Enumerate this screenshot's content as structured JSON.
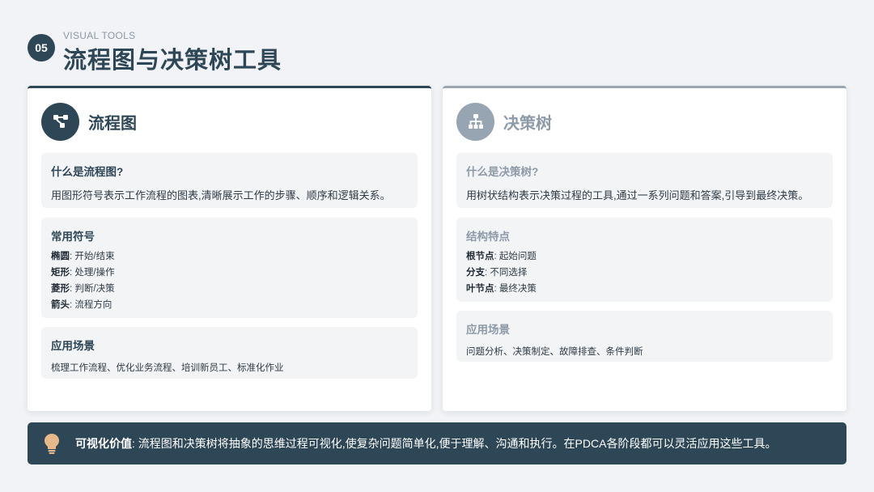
{
  "header": {
    "number": "05",
    "eyebrow": "VISUAL TOOLS",
    "title": "流程图与决策树工具"
  },
  "left_card": {
    "icon": "flowchart-icon",
    "title": "流程图",
    "what": {
      "title": "什么是流程图?",
      "text": "用图形符号表示工作流程的图表,清晰展示工作的步骤、顺序和逻辑关系。"
    },
    "symbols": {
      "title": "常用符号",
      "items": [
        {
          "term": "椭圆",
          "desc": ": 开始/结束"
        },
        {
          "term": "矩形",
          "desc": ": 处理/操作"
        },
        {
          "term": "菱形",
          "desc": ": 判断/决策"
        },
        {
          "term": "箭头",
          "desc": ": 流程方向"
        }
      ]
    },
    "scenarios": {
      "title": "应用场景",
      "text": "梳理工作流程、优化业务流程、培训新员工、标准化作业"
    }
  },
  "right_card": {
    "icon": "hierarchy-tree-icon",
    "title": "决策树",
    "what": {
      "title": "什么是决策树?",
      "text": "用树状结构表示决策过程的工具,通过一系列问题和答案,引导到最终决策。"
    },
    "structure": {
      "title": "结构特点",
      "items": [
        {
          "term": "根节点",
          "desc": ": 起始问题"
        },
        {
          "term": "分支",
          "desc": ": 不同选择"
        },
        {
          "term": "叶节点",
          "desc": ": 最终决策"
        }
      ]
    },
    "scenarios": {
      "title": "应用场景",
      "text": "问题分析、决策制定、故障排查、条件判断"
    }
  },
  "bottom": {
    "icon": "lightbulb-icon",
    "label": "可视化价值",
    "text": ": 流程图和决策树将抽象的思维过程可视化,使复杂问题简单化,便于理解、沟通和执行。在PDCA各阶段都可以灵活应用这些工具。"
  },
  "colors": {
    "primary": "#2e4756",
    "muted": "#97a5b3",
    "background": "#f1f3f6",
    "box": "#f2f4f6"
  }
}
